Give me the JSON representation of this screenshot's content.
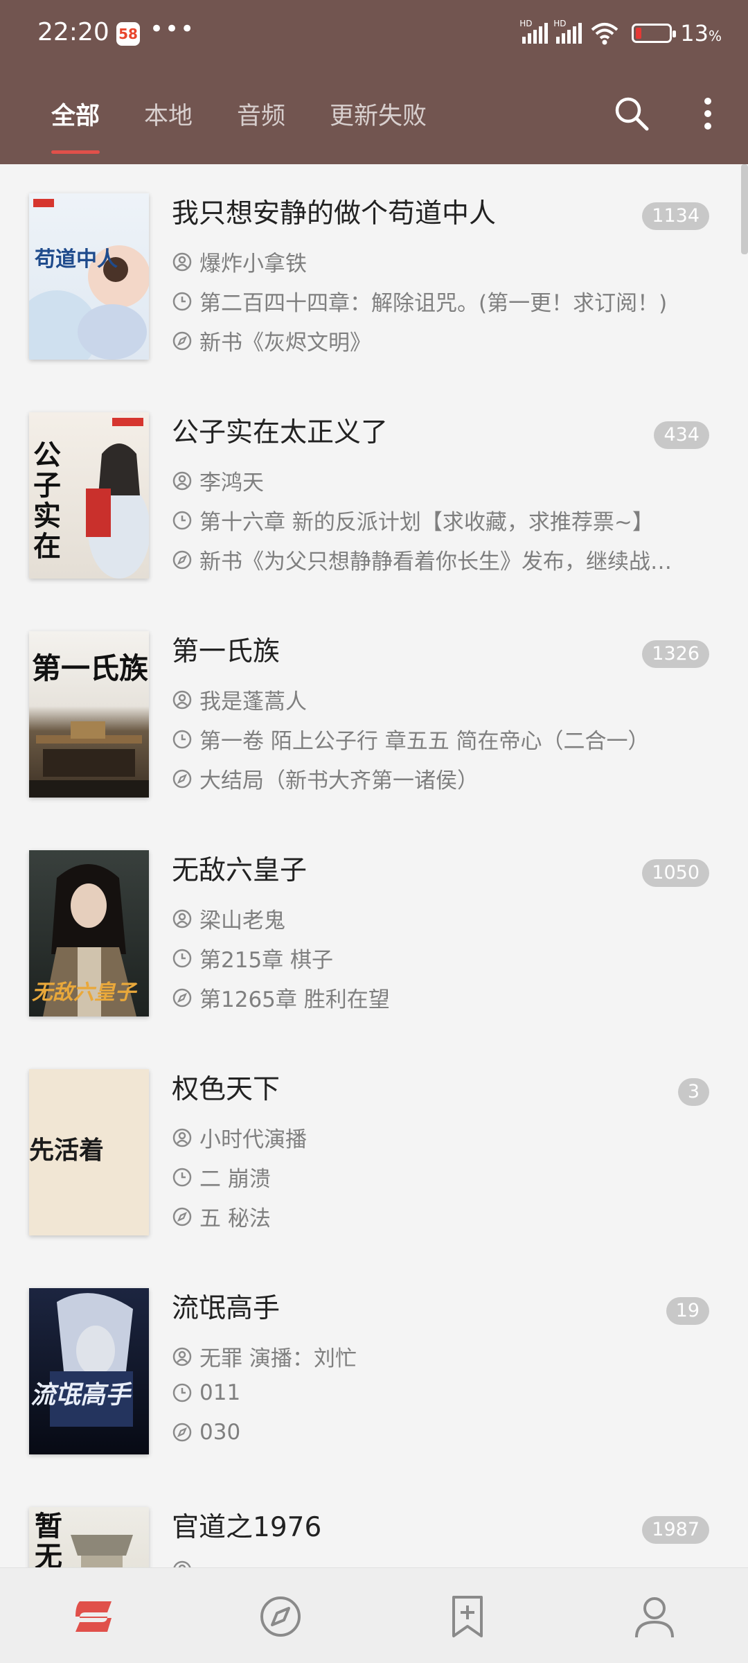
{
  "status_bar": {
    "time": "22:20",
    "app_badge": "58",
    "more": "•••",
    "hd1": "HD",
    "hd2": "HD",
    "battery": "13",
    "battery_unit": "%"
  },
  "tabs": [
    {
      "label": "全部",
      "active": true
    },
    {
      "label": "本地",
      "active": false
    },
    {
      "label": "音频",
      "active": false
    },
    {
      "label": "更新失败",
      "active": false
    }
  ],
  "books": [
    {
      "title": "我只想安静的做个苟道中人",
      "count": "1134",
      "author": "爆炸小拿铁",
      "latest": "第二百四十四章：解除诅咒。(第一更！求订阅！)",
      "update": "新书《灰烬文明》",
      "cover_text": "苟道中人"
    },
    {
      "title": "公子实在太正义了",
      "count": "434",
      "author": "李鸿天",
      "latest": "第十六章 新的反派计划【求收藏，求推荐票~】",
      "update": "新书《为父只想静静看着你长生》发布，继续战…",
      "cover_text": "公子实在"
    },
    {
      "title": "第一氏族",
      "count": "1326",
      "author": "我是蓬蒿人",
      "latest": "第一卷 陌上公子行 章五五 简在帝心（二合一）",
      "update": "大结局（新书大齐第一诸侯）",
      "cover_text": "第一氏族"
    },
    {
      "title": "无敌六皇子",
      "count": "1050",
      "author": "梁山老鬼",
      "latest": "第215章 棋子",
      "update": "第1265章 胜利在望",
      "cover_text": "无敌六皇子"
    },
    {
      "title": "权色天下",
      "count": "3",
      "author": "小时代演播",
      "latest": "二 崩溃",
      "update": "五 秘法",
      "cover_text": "先活着"
    },
    {
      "title": "流氓高手",
      "count": "19",
      "author": "无罪  演播：刘忙",
      "latest": "011",
      "update": "030",
      "cover_text": "流氓高手"
    },
    {
      "title": "官道之1976",
      "count": "1987",
      "author": "",
      "latest": "",
      "update": "",
      "cover_text": "暂无"
    }
  ],
  "colors": {
    "header": "#725550",
    "accent": "#e0504a",
    "badge": "#c8c8c8"
  },
  "icons": [
    "search-icon",
    "more-vert-icon",
    "user-icon",
    "clock-icon",
    "compass-icon",
    "bookshelf-icon",
    "discover-icon",
    "bookmark-add-icon",
    "profile-icon"
  ]
}
